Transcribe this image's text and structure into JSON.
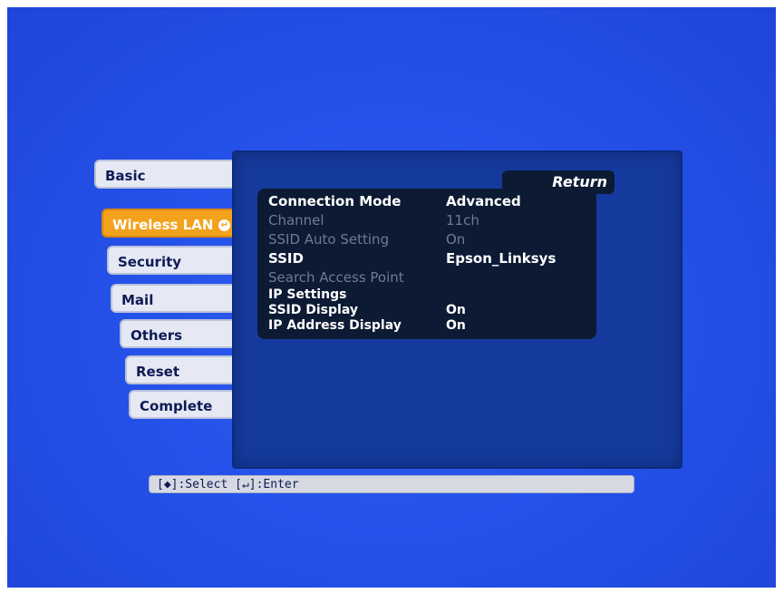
{
  "tabs": [
    {
      "label": "Basic"
    },
    {
      "label": "Wireless LAN"
    },
    {
      "label": "Security"
    },
    {
      "label": "Mail"
    },
    {
      "label": "Others"
    },
    {
      "label": "Reset"
    },
    {
      "label": "Complete"
    }
  ],
  "panel": {
    "return_label": "Return",
    "items": [
      {
        "label": "Connection Mode",
        "value": "Advanced"
      },
      {
        "label": "Channel",
        "value": "11ch"
      },
      {
        "label": "SSID Auto Setting",
        "value": "On"
      },
      {
        "label": "SSID",
        "value": "Epson_Linksys"
      },
      {
        "label": "Search Access Point",
        "value": ""
      },
      {
        "label": "IP Settings",
        "value": ""
      },
      {
        "label": "SSID Display",
        "value": "On"
      },
      {
        "label": "IP Address Display",
        "value": "On"
      }
    ]
  },
  "help": {
    "select_text": ":Select",
    "enter_text": ":Enter"
  },
  "colors": {
    "background": "#2552ea",
    "active_tab": "#f4a11c",
    "panel": "#153a9e"
  },
  "icons": {
    "active_tab_icon": "enter-icon",
    "select_icon": "up-down-arrow-icon",
    "enter_icon": "enter-icon"
  }
}
